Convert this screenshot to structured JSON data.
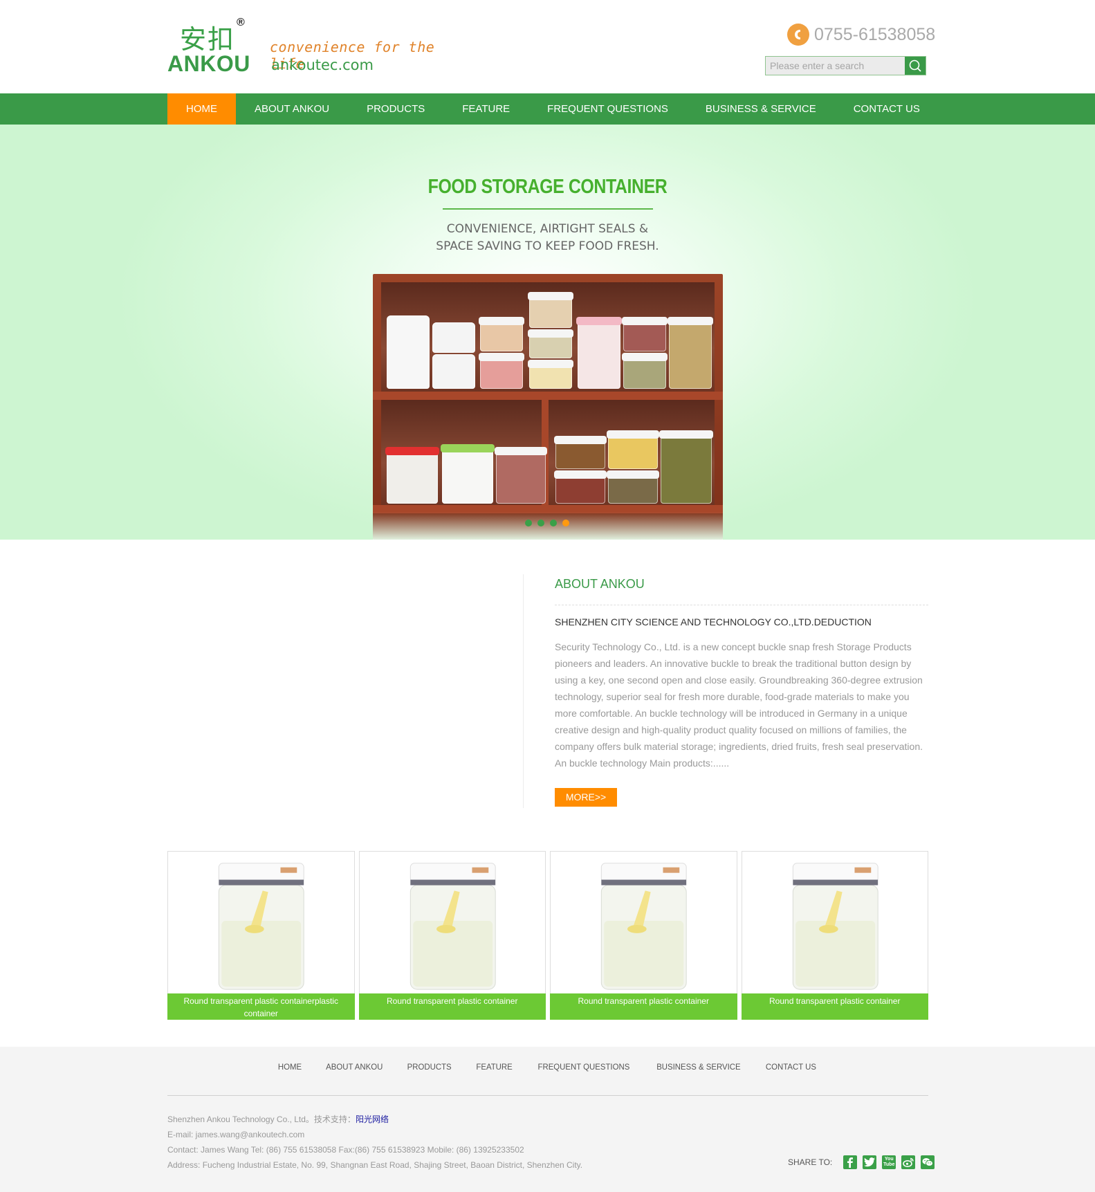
{
  "header": {
    "logo_cn": "安扣",
    "logo_reg": "®",
    "logo_en": "ANKOU",
    "slogan": "convenience for the life",
    "domain": "ankoutec.com",
    "phone_icon": "phone-icon",
    "phone": "0755-61538058",
    "search": {
      "placeholder": "Please enter a search",
      "value": "",
      "button_icon": "search-icon"
    }
  },
  "nav": {
    "items": [
      {
        "label": "HOME",
        "active": true
      },
      {
        "label": "ABOUT ANKOU",
        "active": false
      },
      {
        "label": "PRODUCTS",
        "active": false
      },
      {
        "label": "FEATURE",
        "active": false
      },
      {
        "label": "FREQUENT QUESTIONS",
        "active": false
      },
      {
        "label": "BUSINESS & SERVICE",
        "active": false
      },
      {
        "label": "CONTACT US",
        "active": false
      }
    ]
  },
  "banner": {
    "title": "FOOD STORAGE CONTAINER",
    "subtitle_line1": "CONVENIENCE, AIRTIGHT SEALS &",
    "subtitle_line2": "SPACE SAVING TO KEEP FOOD FRESH.",
    "image": "shelf-with-storage-containers",
    "slides_total": 4,
    "active_slide": 4
  },
  "about": {
    "title": "ABOUT ANKOU",
    "subtitle": "SHENZHEN CITY SCIENCE AND TECHNOLOGY CO.,LTD.DEDUCTION",
    "body": "Security Technology Co., Ltd. is a new concept buckle snap fresh Storage Products pioneers and leaders. An innovative buckle to break the traditional button design by using a key, one second open and close easily. Groundbreaking 360-degree extrusion technology, superior seal for fresh more durable, food-grade materials to make you more comfortable. An buckle technology will be introduced in Germany in a unique creative design and high-quality product quality focused on millions of families, the company offers bulk material storage; ingredients, dried fruits, fresh seal preservation. An buckle technology Main products:......",
    "more_label": "MORE>>"
  },
  "products": [
    {
      "caption": "Round transparent plastic containerplastic container",
      "image": "container-with-powder-and-scoop"
    },
    {
      "caption": "Round transparent plastic container",
      "image": "container-with-powder-and-scoop"
    },
    {
      "caption": "Round transparent plastic container",
      "image": "container-with-powder-and-scoop"
    },
    {
      "caption": "Round transparent plastic container",
      "image": "container-with-powder-and-scoop"
    }
  ],
  "footer": {
    "nav": [
      "HOME",
      "ABOUT ANKOU",
      "PRODUCTS",
      "FEATURE",
      "FREQUENT QUESTIONS",
      "BUSINESS & SERVICE",
      "CONTACT US"
    ],
    "company": "Shenzhen Ankou Technology Co., Ltd。技术支持：",
    "tech_support": "阳光网络",
    "email": "E-mail: james.wang@ankoutech.com",
    "contact": "Contact: James Wang Tel: (86) 755 61538058 Fax:(86) 755 61538923 Mobile: (86) 13925233502",
    "address": "Address: Fucheng Industrial Estate, No. 99, Shangnan East Road, Shajing Street, Baoan District, Shenzhen City.",
    "share_label": "SHARE TO:",
    "share_icons": [
      {
        "name": "facebook-icon",
        "glyph": "f"
      },
      {
        "name": "twitter-icon",
        "glyph": "t"
      },
      {
        "name": "youtube-icon",
        "glyph": "You Tube"
      },
      {
        "name": "weibo-icon",
        "glyph": "微"
      },
      {
        "name": "wechat-icon",
        "glyph": "信"
      }
    ]
  },
  "colors": {
    "brand_green": "#3a9a48",
    "accent_orange": "#ff8c00",
    "caption_green": "#6cc934",
    "banner_title_green": "#46b02e"
  }
}
